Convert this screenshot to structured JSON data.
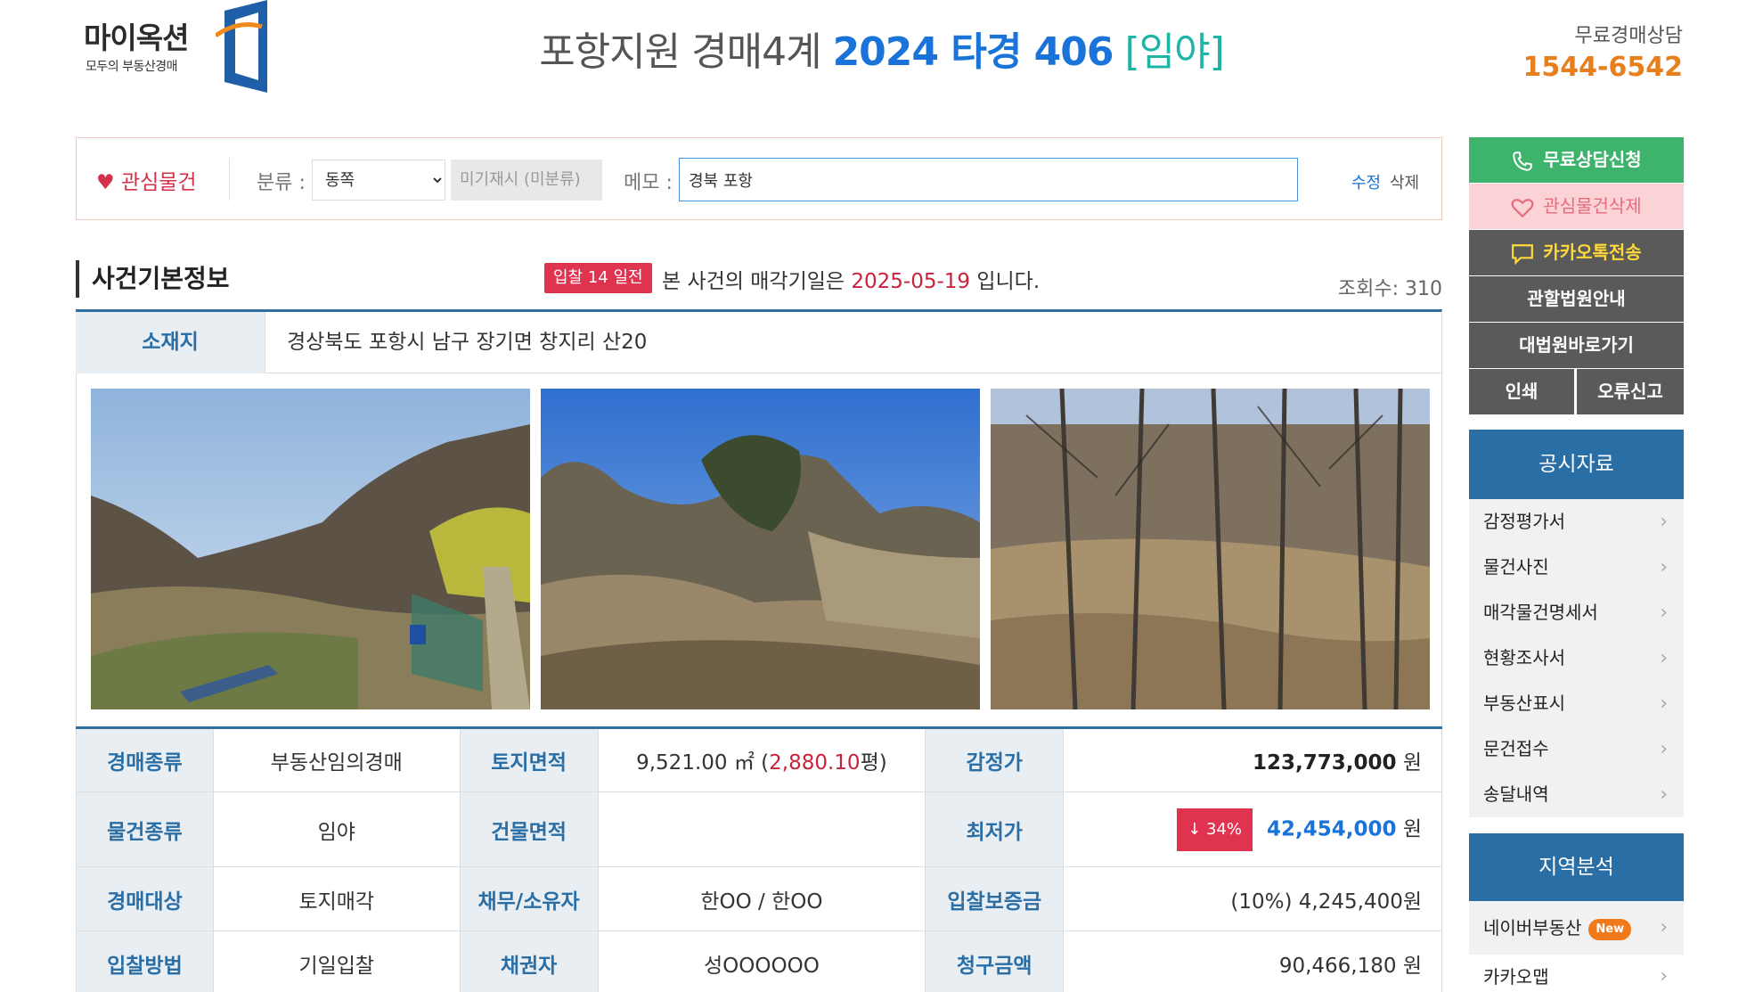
{
  "logo": {
    "main": "마이옥션",
    "tagline": "모두의 부동산경매"
  },
  "header": {
    "court": "포항지원 경매4계",
    "case_no": "2024 타경 406",
    "kind": "[임야]"
  },
  "consult": {
    "label": "무료경매상담",
    "phone": "1544-6542"
  },
  "interest": {
    "heart": "♥",
    "label": "관심물건",
    "category_label": "분류 :",
    "category_value": "동쪽",
    "unassigned": "미기재시 (미분류)",
    "memo_label": "메모 :",
    "memo_value": "경북 포항",
    "edit": "수정",
    "delete": "삭제"
  },
  "case_info": {
    "title": "사건기본정보",
    "bid_badge": "입찰 14 일전",
    "notice_pre": "본 사건의 매각기일은 ",
    "sale_date": "2025-05-19",
    "notice_post": " 입니다.",
    "views": "조회수: 310"
  },
  "address": {
    "label": "소재지",
    "value": "경상북도 포항시 남구 장기면 창지리 산20"
  },
  "table": {
    "auction_type_label": "경매종류",
    "auction_type": "부동산임의경매",
    "land_area_label": "토지면적",
    "land_area_m2": "9,521.00 ㎡ (",
    "land_area_py": "2,880.10",
    "land_area_unit": "평)",
    "appraisal_label": "감정가",
    "appraisal": "123,773,000",
    "won": "원",
    "item_type_label": "물건종류",
    "item_type": "임야",
    "building_area_label": "건물면적",
    "building_area": "",
    "min_price_label": "최저가",
    "discount": "↓ 34%",
    "min_price": "42,454,000",
    "target_label": "경매대상",
    "target": "토지매각",
    "debtor_label": "채무/소유자",
    "debtor": "한OO / 한OO",
    "deposit_label": "입찰보증금",
    "deposit": "(10%) 4,245,400원",
    "method_label": "입찰방법",
    "method": "기일입찰",
    "creditor_label": "채권자",
    "creditor": "성OOOOOO",
    "claim_label": "청구금액",
    "claim": "90,466,180"
  },
  "sidebar": {
    "consult_request": "무료상담신청",
    "delete_interest": "관심물건삭제",
    "kakao_send": "카카오톡전송",
    "court_guide": "관할법원안내",
    "supreme_court": "대법원바로가기",
    "print": "인쇄",
    "report_error": "오류신고",
    "public_docs": {
      "title": "공시자료",
      "items": [
        "감정평가서",
        "물건사진",
        "매각물건명세서",
        "현황조사서",
        "부동산표시",
        "문건접수",
        "송달내역"
      ]
    },
    "area_analysis": {
      "title": "지역분석",
      "items": [
        "네이버부동산",
        "카카오맵"
      ],
      "new_badge": "New"
    }
  },
  "colors": {
    "brand_blue": "#1a73d9",
    "header_blue": "#2a6ea6",
    "accent_red": "#e0334f",
    "green": "#3db36c",
    "orange": "#e87e1c"
  }
}
